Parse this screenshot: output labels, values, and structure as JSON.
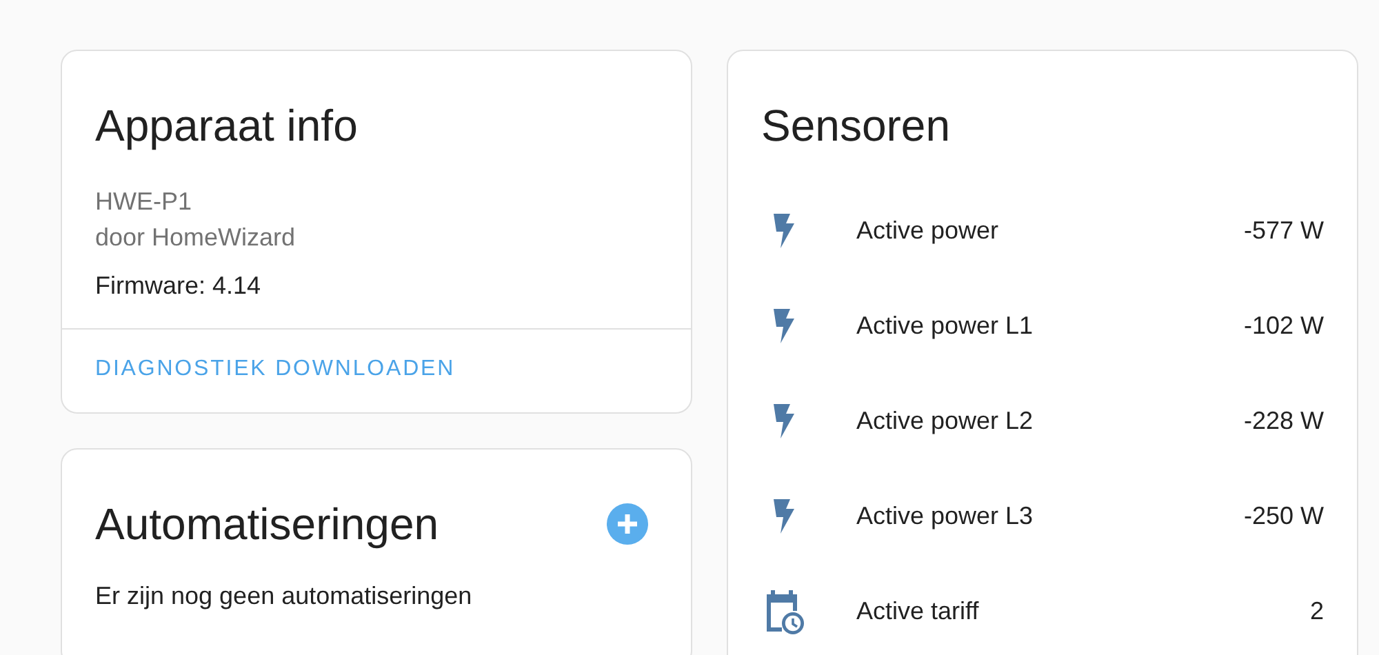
{
  "device_info": {
    "title": "Apparaat info",
    "model": "HWE-P1",
    "manufacturer": "door HomeWizard",
    "firmware": "Firmware: 4.14",
    "action": "DIAGNOSTIEK DOWNLOADEN"
  },
  "automations": {
    "title": "Automatiseringen",
    "empty_text": "Er zijn nog geen automatiseringen"
  },
  "sensors": {
    "title": "Sensoren",
    "items": [
      {
        "kind": "power",
        "name": "Active power",
        "value": "-577 W"
      },
      {
        "kind": "power",
        "name": "Active power L1",
        "value": "-102 W"
      },
      {
        "kind": "power",
        "name": "Active power L2",
        "value": "-228 W"
      },
      {
        "kind": "power",
        "name": "Active power L3",
        "value": "-250 W"
      },
      {
        "kind": "tariff",
        "name": "Active tariff",
        "value": "2"
      }
    ]
  }
}
